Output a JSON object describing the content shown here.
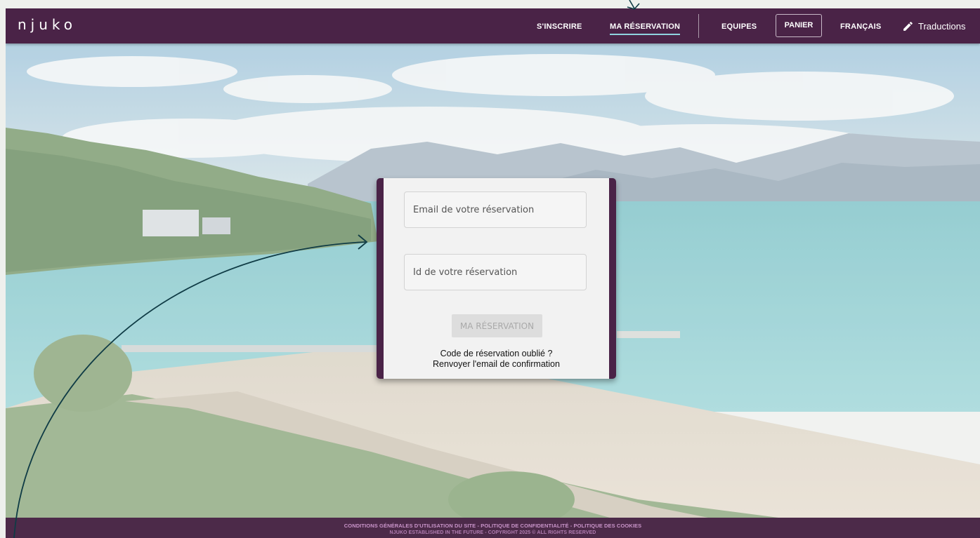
{
  "navbar": {
    "logo": "njuko",
    "signup": "S'INSCRIRE",
    "my_reservation": "MA RÉSERVATION",
    "teams": "EQUIPES",
    "cart": "PANIER",
    "language": "FRANÇAIS",
    "translations": "Traductions",
    "active_item": "MA RÉSERVATION",
    "accent_color": "#8fd3df"
  },
  "reservation_form": {
    "email_placeholder": "Email de votre réservation",
    "id_placeholder": "Id de votre réservation",
    "submit_label": "MA RÉSERVATION",
    "forgot_code": "Code de réservation oublié ?",
    "resend_email": "Renvoyer l'email de confirmation"
  },
  "footer": {
    "links": "CONDITIONS GÉNÉRALES D'UTILISATION DU SITE - POLITIQUE DE CONFIDENTIALITÉ - POLITIQUE DES COOKIES",
    "copyright": "NJUKO ESTABLISHED IN THE FUTURE - COPYRIGHT 2025 © ALL RIGHTS RESERVED"
  },
  "colors": {
    "brand": "#4a2347",
    "annotation_arrow": "#0f3b45"
  },
  "icons": {
    "translations": "pencil-icon"
  }
}
